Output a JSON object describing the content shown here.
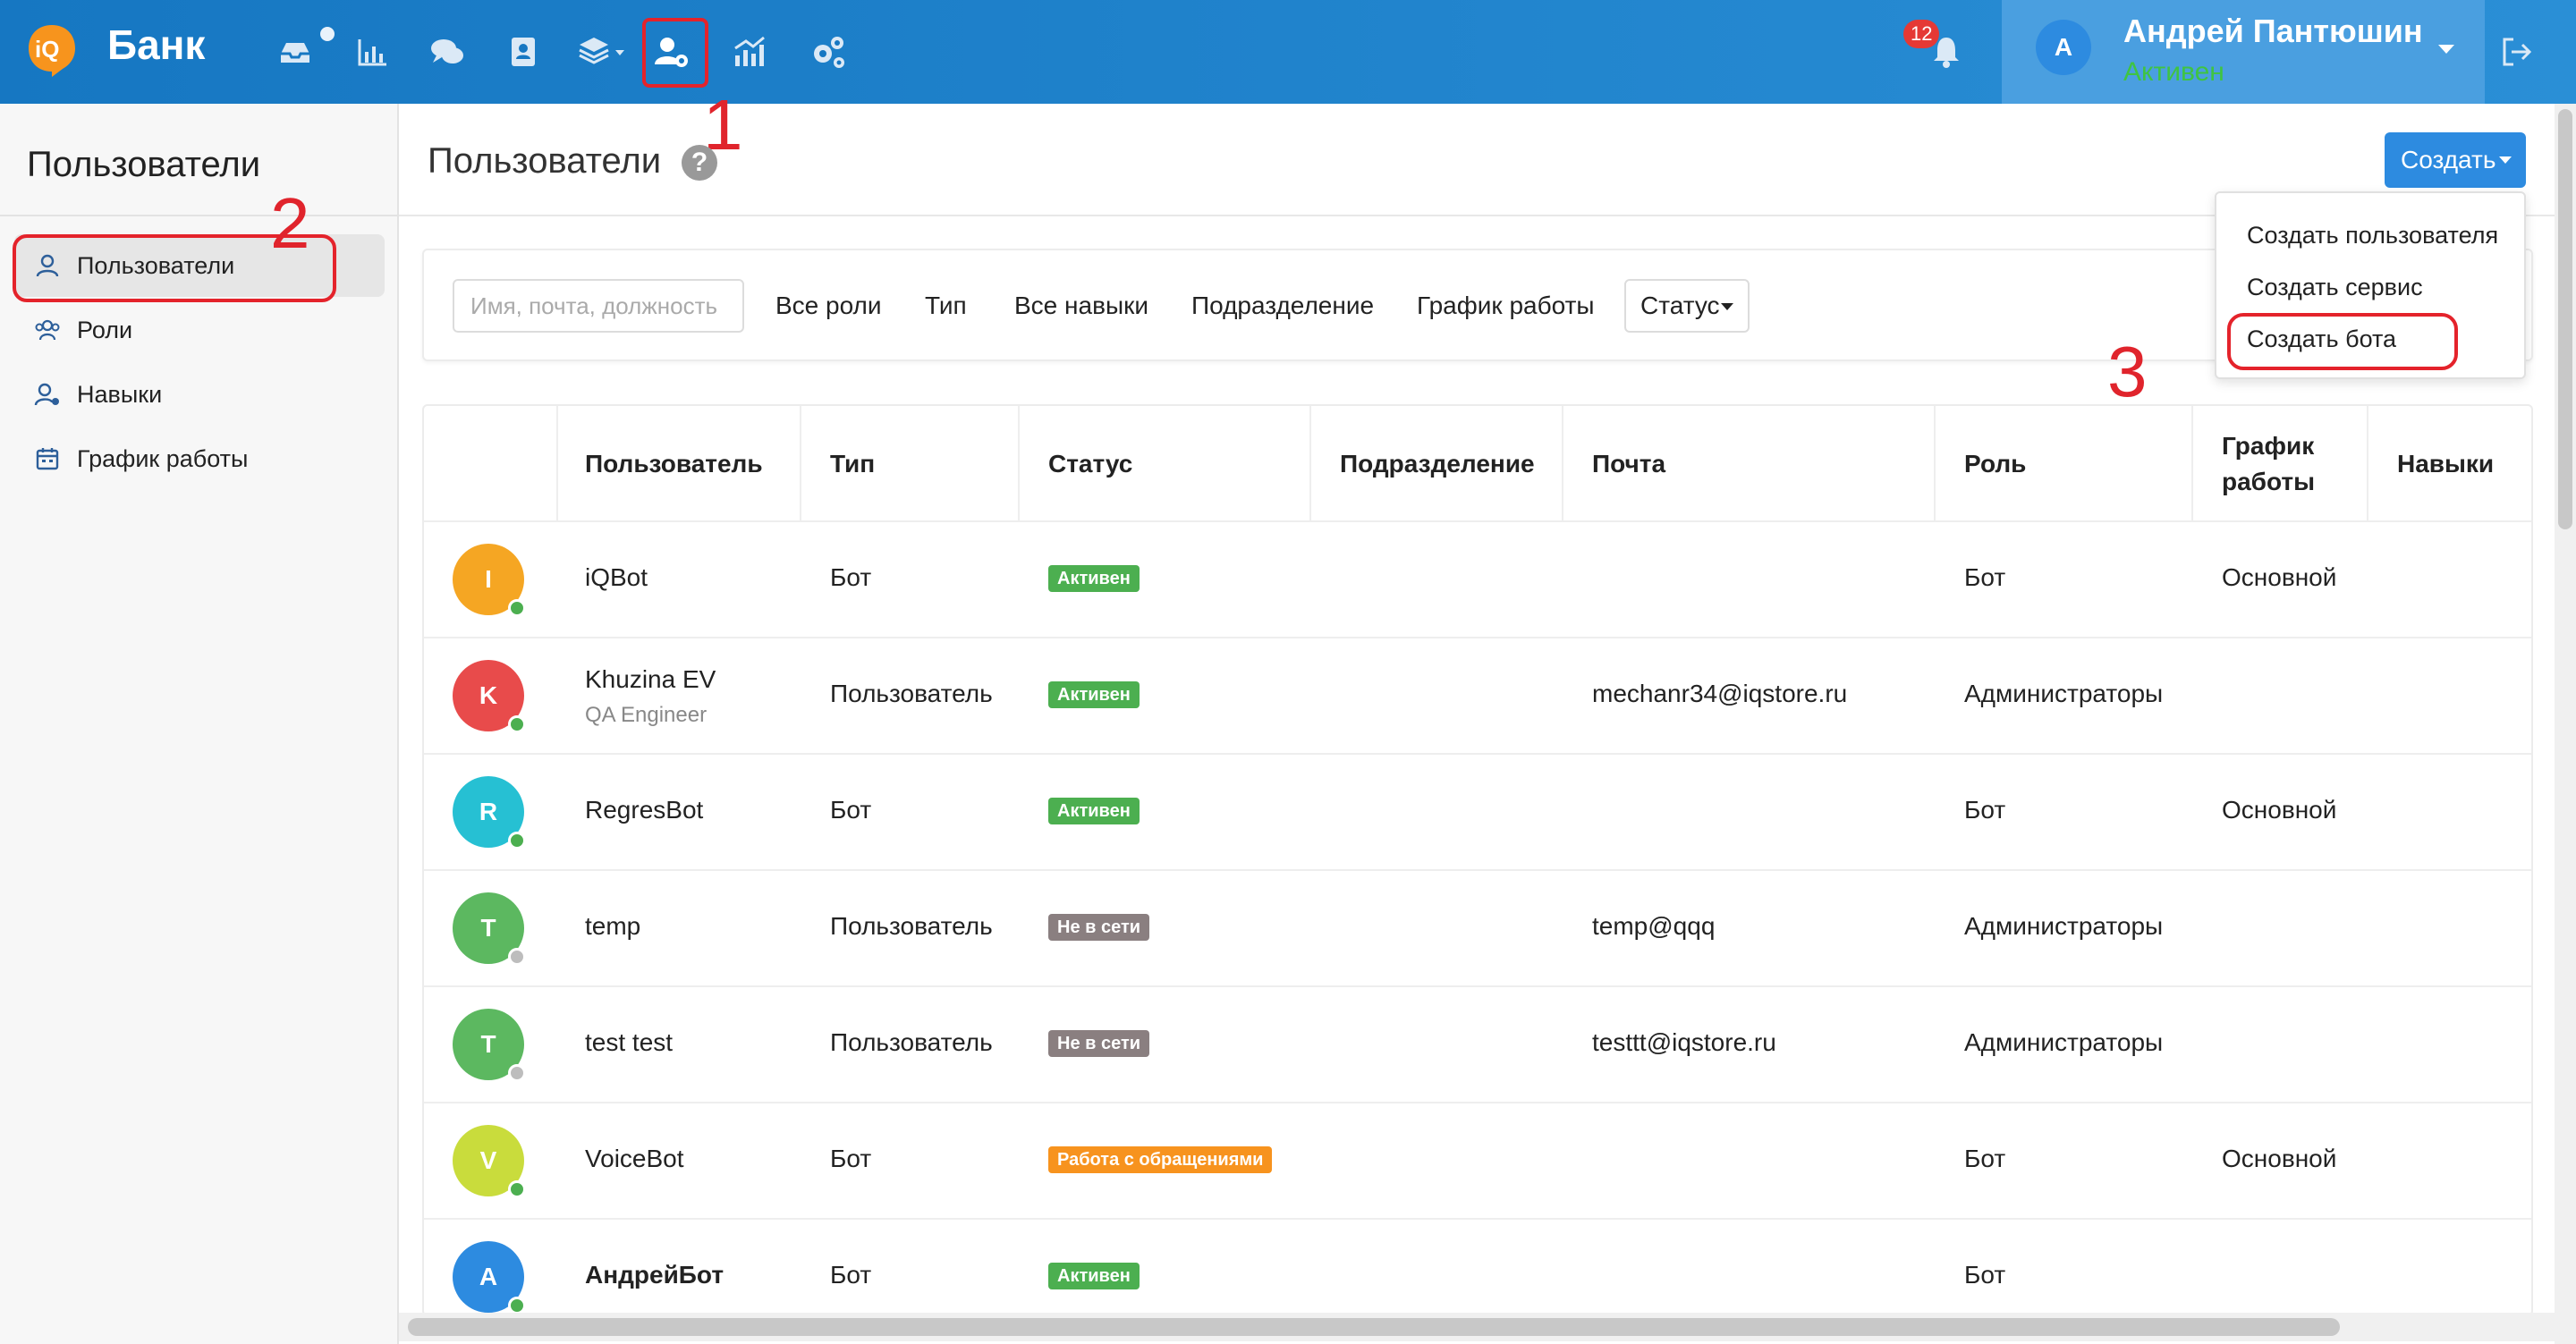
{
  "header": {
    "brand": "Банк",
    "notifications_count": "12",
    "user": {
      "avatar_letter": "А",
      "name": "Андрей Пантюшин",
      "status": "Активен"
    }
  },
  "annotations": {
    "n1": "1",
    "n2": "2",
    "n3": "3"
  },
  "sidebar": {
    "title": "Пользователи",
    "items": [
      {
        "label": "Пользователи",
        "icon": "user-icon"
      },
      {
        "label": "Роли",
        "icon": "users-icon"
      },
      {
        "label": "Навыки",
        "icon": "user-skill-icon"
      },
      {
        "label": "График работы",
        "icon": "calendar-icon"
      }
    ]
  },
  "main": {
    "title": "Пользователи",
    "help": "?",
    "create_label": "Создать",
    "dropdown": [
      "Создать пользователя",
      "Создать сервис",
      "Создать бота"
    ]
  },
  "filters": {
    "search_placeholder": "Имя, почта, должность",
    "roles": "Все роли",
    "type": "Тип",
    "skills": "Все навыки",
    "department": "Подразделение",
    "schedule": "График работы",
    "status": "Статус"
  },
  "table": {
    "headers": {
      "user": "Пользователь",
      "type": "Тип",
      "status": "Статус",
      "department": "Подразделение",
      "email": "Почта",
      "role": "Роль",
      "schedule_l1": "График",
      "schedule_l2": "работы",
      "skills": "Навыки"
    },
    "rows": [
      {
        "letter": "I",
        "color": "#f5a623",
        "online": "#4caf50",
        "name": "iQBot",
        "subtitle": "",
        "type": "Бот",
        "status": "Активен",
        "status_color": "#4caf50",
        "email": "",
        "role": "Бот",
        "schedule": "Основной"
      },
      {
        "letter": "K",
        "color": "#e84b4b",
        "online": "#4caf50",
        "name": "Khuzina EV",
        "subtitle": "QA Engineer",
        "type": "Пользователь",
        "status": "Активен",
        "status_color": "#4caf50",
        "email": "mechanr34@iqstore.ru",
        "role": "Администраторы",
        "schedule": ""
      },
      {
        "letter": "R",
        "color": "#26c0d3",
        "online": "#4caf50",
        "name": "RegresBot",
        "subtitle": "",
        "type": "Бот",
        "status": "Активен",
        "status_color": "#4caf50",
        "email": "",
        "role": "Бот",
        "schedule": "Основной"
      },
      {
        "letter": "T",
        "color": "#5cb860",
        "online": "#bdbdbd",
        "name": "temp",
        "subtitle": "",
        "type": "Пользователь",
        "status": "Не в сети",
        "status_color": "#8a7f80",
        "email": "temp@qqq",
        "role": "Администраторы",
        "schedule": ""
      },
      {
        "letter": "T",
        "color": "#5cb860",
        "online": "#bdbdbd",
        "name": "test test",
        "subtitle": "",
        "type": "Пользователь",
        "status": "Не в сети",
        "status_color": "#8a7f80",
        "email": "testtt@iqstore.ru",
        "role": "Администраторы",
        "schedule": ""
      },
      {
        "letter": "V",
        "color": "#c9dc3c",
        "online": "#4caf50",
        "name": "VoiceBot",
        "subtitle": "",
        "type": "Бот",
        "status": "Работа с обращениями",
        "status_color": "#f7931e",
        "email": "",
        "role": "Бот",
        "schedule": "Основной"
      },
      {
        "letter": "А",
        "color": "#2d8be0",
        "online": "#4caf50",
        "name": "АндрейБот",
        "subtitle": "",
        "type": "Бот",
        "status": "Активен",
        "status_color": "#4caf50",
        "email": "",
        "role": "Бот",
        "schedule": ""
      }
    ]
  }
}
